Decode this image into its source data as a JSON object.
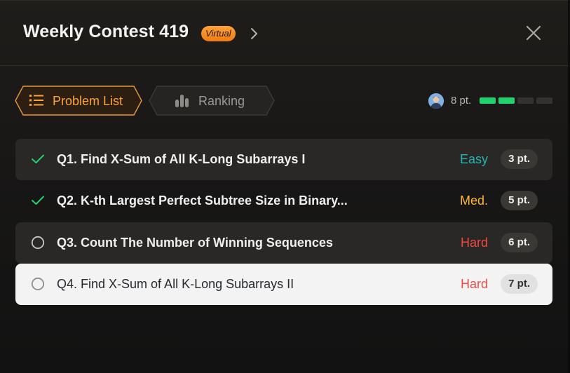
{
  "header": {
    "title": "Weekly Contest 419",
    "badge": "Virtual",
    "chevron_icon": "chevron-right-icon",
    "close_icon": "close-icon"
  },
  "tabs": [
    {
      "label": "Problem List",
      "icon": "list-icon",
      "active": true
    },
    {
      "label": "Ranking",
      "icon": "bar-chart-icon",
      "active": false
    }
  ],
  "progress": {
    "avatar_icon": "user-avatar",
    "points": "8 pt.",
    "segments_filled": 2,
    "segments_total": 4
  },
  "problems": [
    {
      "title": "Q1. Find X-Sum of All K-Long Subarrays I",
      "difficulty": "Easy",
      "points": "3 pt.",
      "solved": true
    },
    {
      "title": "Q2. K-th Largest Perfect Subtree Size in Binary...",
      "difficulty": "Med.",
      "points": "5 pt.",
      "solved": true
    },
    {
      "title": "Q3. Count The Number of Winning Sequences",
      "difficulty": "Hard",
      "points": "6 pt.",
      "solved": false
    },
    {
      "title": "Q4. Find X-Sum of All K-Long Subarrays II",
      "difficulty": "Hard",
      "points": "7 pt.",
      "solved": false
    }
  ],
  "colors": {
    "accent_orange": "#ffa23a",
    "solved_green": "#1fd26d",
    "easy": "#23b6b6",
    "medium": "#ffb534",
    "hard": "#f04b43"
  }
}
